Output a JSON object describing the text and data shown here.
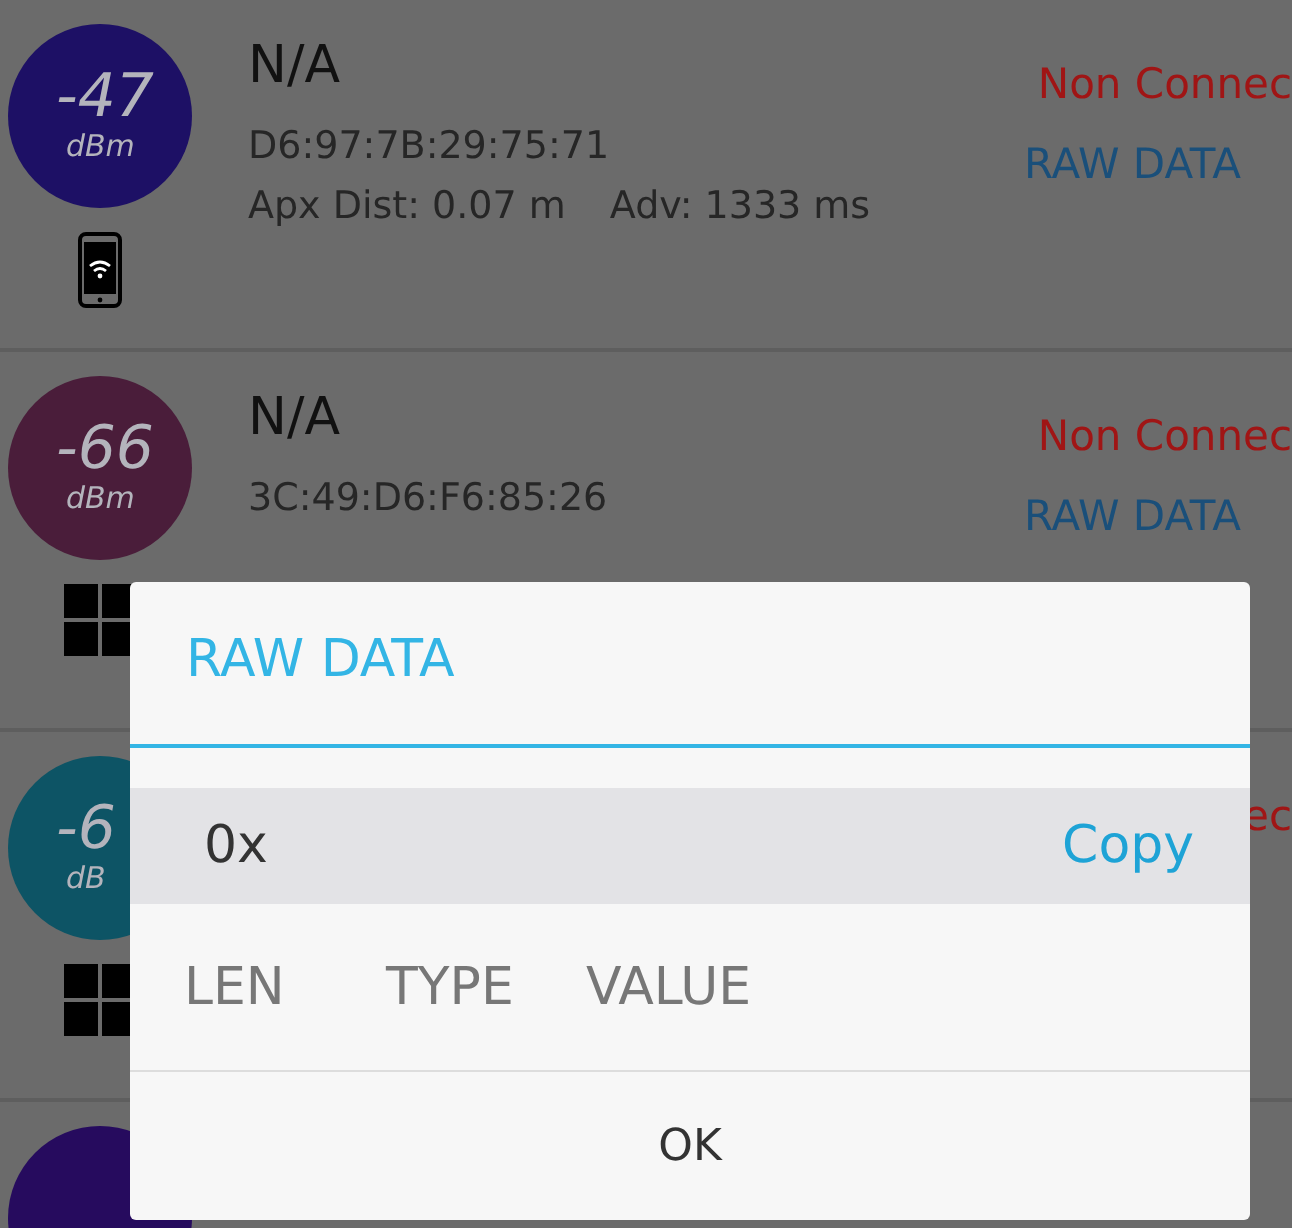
{
  "devices": [
    {
      "rssi": "-47",
      "unit": "dBm",
      "color": "#1d1065",
      "kind": "phone",
      "name": "N/A",
      "mac": "D6:97:7B:29:75:71",
      "distance": "Apx Dist: 0.07 m",
      "adv": "Adv: 1333 ms",
      "status": "Non Connec",
      "raw_button": "RAW DATA"
    },
    {
      "rssi": "-66",
      "unit": "dBm",
      "color": "#4a1d3a",
      "kind": "windows",
      "name": "N/A",
      "mac": "3C:49:D6:F6:85:26",
      "status": "Non Connec",
      "raw_button": "RAW DATA"
    },
    {
      "rssi": "-6",
      "unit": "dB",
      "color": "#0d5465",
      "kind": "windows",
      "status": "ec"
    },
    {
      "color": "#260b5e"
    }
  ],
  "dialog": {
    "title": "RAW DATA",
    "hex": "0x",
    "copy_button": "Copy",
    "columns": [
      "LEN",
      "TYPE",
      "VALUE"
    ],
    "ok_button": "OK"
  }
}
